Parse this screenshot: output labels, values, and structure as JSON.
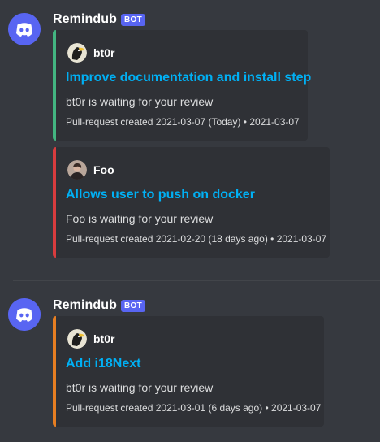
{
  "messages": [
    {
      "username": "Remindub",
      "bot_tag": "BOT",
      "embeds": [
        {
          "author": "bt0r",
          "title": "Improve documentation and install step",
          "description": "bt0r is waiting for your review",
          "footer": "Pull-request created 2021-03-07 (Today) • 2021-03-07",
          "color": "#43b581"
        },
        {
          "author": "Foo",
          "title": "Allows user to push on docker",
          "description": "Foo is waiting for your review",
          "footer": "Pull-request created 2021-02-20 (18 days ago) • 2021-03-07",
          "color": "#d83c3e"
        }
      ]
    },
    {
      "username": "Remindub",
      "bot_tag": "BOT",
      "embeds": [
        {
          "author": "bt0r",
          "title": "Add i18Next",
          "description": "bt0r is waiting for your review",
          "footer": "Pull-request created 2021-03-01 (6 days ago) • 2021-03-07",
          "color": "#e67e22"
        }
      ]
    }
  ],
  "colors": {
    "background": "#36393f",
    "embed_background": "#2f3136",
    "link": "#00b0f4",
    "brand": "#5865f2"
  }
}
